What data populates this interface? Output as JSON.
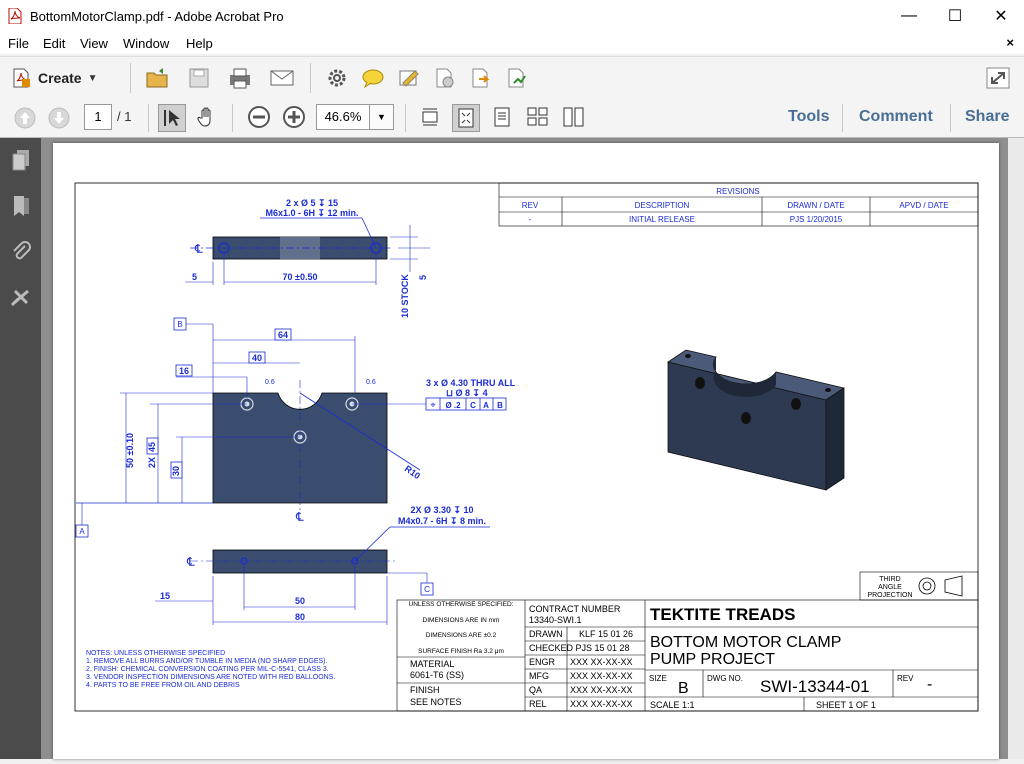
{
  "window": {
    "title": "BottomMotorClamp.pdf - Adobe Acrobat Pro",
    "minimize": "—",
    "maximize": "☐",
    "close": "✕"
  },
  "menu": {
    "items": [
      "File",
      "Edit",
      "View",
      "Window",
      "Help"
    ],
    "close_doc": "×"
  },
  "toolbar": {
    "create_label": "Create",
    "page_current": "1",
    "page_total": "/ 1",
    "zoom": "46.6%",
    "tools_label": "Tools",
    "comment_label": "Comment",
    "share_label": "Share"
  },
  "drawing": {
    "revisions": {
      "title": "REVISIONS",
      "headers": [
        "REV",
        "DESCRIPTION",
        "DRAWN / DATE",
        "APVD / DATE"
      ],
      "row": [
        "-",
        "INITIAL RELEASE",
        "PJS 1/20/2015",
        ""
      ]
    },
    "top_view": {
      "callout1": "2 x Ø 5 ↧ 15",
      "callout2": "M6x1.0 - 6H ↧ 12 min.",
      "dim_5": "5",
      "dim_70": "70 ±0.50",
      "dim_10stock": "10 STOCK",
      "dim_5r": "5"
    },
    "front_view": {
      "datum_b": "B",
      "dim_64": "64",
      "dim_40": "40",
      "dim_16": "16",
      "dim_06a": "0.6",
      "dim_06b": "0.6",
      "hole_callout1": "3 x Ø 4.30 THRU ALL",
      "hole_callout2": "⊔ Ø 8 ↧ 4",
      "fcf_sym": "⌖",
      "fcf_tol": "Ø .2",
      "fcf_c": "C",
      "fcf_a": "A",
      "fcf_b": "B",
      "dim_50": "50 ±0.10",
      "dim_2x45": "2X",
      "dim_45": "45",
      "dim_30": "30",
      "radius": "R10",
      "datum_a": "A",
      "cl": "℄"
    },
    "bottom_view": {
      "callout1": "2X Ø 3.30 ↧ 10",
      "callout2": "M4x0.7 - 6H ↧ 8  min.",
      "dim_15": "15",
      "dim_50": "50",
      "dim_80": "80",
      "datum_c": "C",
      "cl": "℄"
    },
    "notes": [
      "NOTES:   UNLESS OTHERWISE SPECIFIED",
      "1. REMOVE ALL BURRS AND/OR TUMBLE IN MEDIA (NO SHARP EDGES).",
      "2. FINISH:  CHEMICAL CONVERSION COATING PER MIL-C-5541, CLASS 3.",
      "3. VENDOR INSPECTION DIMENSIONS ARE NOTED WITH RED BALLOONS.",
      "4. PARTS TO BE FREE FROM OIL AND DEBRIS"
    ],
    "tolerances": {
      "head": "UNLESS OTHERWISE SPECIFIED:",
      "dims": "DIMENSIONS ARE IN mm",
      "tol": "DIMENSIONS ARE ±0.2",
      "finish": "SURFACE FINISH Ra 3.2 μm",
      "material_label": "MATERIAL",
      "material": "6061-T6 (SS)",
      "finish_label": "FINISH",
      "finish_val": "SEE NOTES"
    },
    "titleblock": {
      "contract_label": "CONTRACT NUMBER",
      "contract": "13340-SWI.1",
      "drawn_label": "DRAWN",
      "drawn": "KLF  15 01 26",
      "checked": "CHECKED PJS  15 01 28",
      "engr": "ENGR",
      "mfg": "MFG",
      "qa": "QA",
      "rel": "REL",
      "xxx": "XXX  XX-XX-XX",
      "company": "TEKTITE TREADS",
      "title1": "BOTTOM MOTOR CLAMP",
      "title2": "PUMP PROJECT",
      "size_label": "SIZE",
      "size": "B",
      "dwg_label": "DWG NO.",
      "dwg": "SWI-13344-01",
      "rev_label": "REV",
      "rev": "-",
      "scale": "SCALE 1:1",
      "sheet": "SHEET 1 OF 1",
      "projection1": "THIRD",
      "projection2": "ANGLE",
      "projection3": "PROJECTION"
    }
  },
  "colors": {
    "dimension_blue": "#1a2bd6",
    "part_fill": "#3a4d6e",
    "panel_gray": "#4b4b4b",
    "viewer_gray": "#8e8e8e",
    "link_blue": "#4a6e94"
  }
}
